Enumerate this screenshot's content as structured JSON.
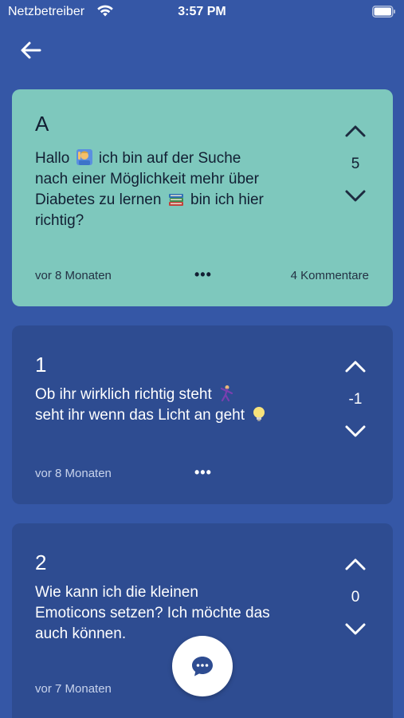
{
  "status_bar": {
    "carrier": "Netzbetreiber",
    "time": "3:57 PM"
  },
  "header": {
    "back_icon": "arrow-left-icon"
  },
  "posts": [
    {
      "author": "A",
      "text_lines": [
        {
          "before": "Hallo ",
          "emoji": "person-raising-hand-emoji",
          "after": " ich bin auf der Suche"
        },
        {
          "text": "nach einer Möglichkeit mehr über"
        },
        {
          "before": "Diabetes zu lernen ",
          "emoji": "books-emoji",
          "after": " bin ich hier"
        },
        {
          "text": "richtig?"
        }
      ],
      "votes": "5",
      "date": "vor 8 Monaten",
      "more": "•••",
      "comments": "4 Kommentare",
      "highlighted": true
    },
    {
      "author": "1",
      "text_lines": [
        {
          "before": "Ob ihr wirklich richtig steht ",
          "emoji": "dancer-emoji",
          "after": ""
        },
        {
          "before": "seht ihr wenn das Licht an geht ",
          "emoji": "light-bulb-emoji",
          "after": ""
        }
      ],
      "votes": "-1",
      "date": "vor 8 Monaten",
      "more": "•••",
      "highlighted": false
    },
    {
      "author": "2",
      "text_lines": [
        {
          "text": "Wie kann ich die kleinen"
        },
        {
          "text": "Emoticons setzen? Ich möchte das"
        },
        {
          "text": "auch können."
        }
      ],
      "votes": "0",
      "date": "vor 7 Monaten",
      "highlighted": false
    }
  ],
  "fab": {
    "icon": "chat-bubble-icon"
  },
  "colors": {
    "background": "#3557a6",
    "highlight_card": "#7ec8bd",
    "normal_card": "#2e4c91"
  }
}
